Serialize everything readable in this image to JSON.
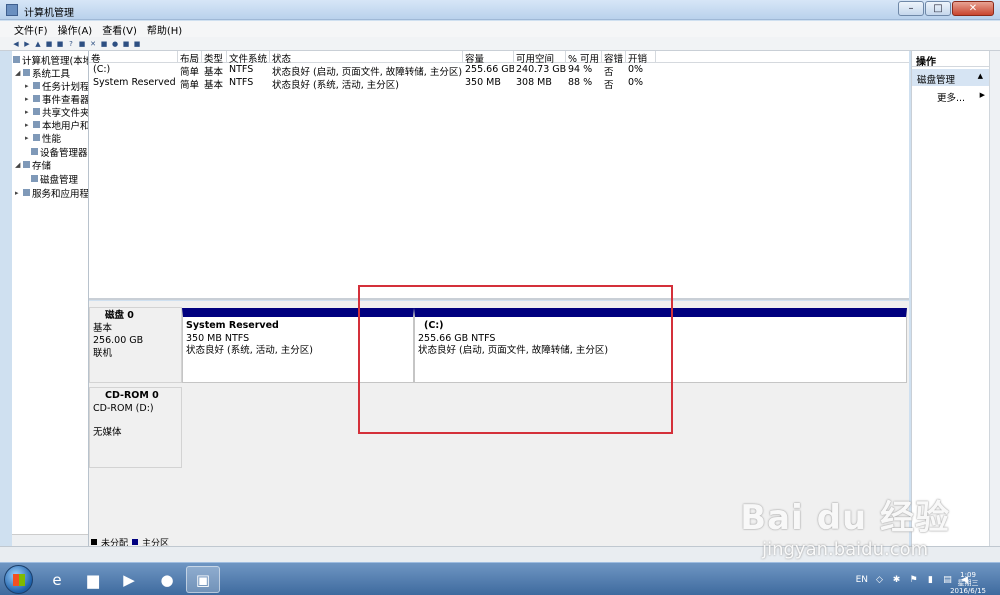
{
  "window": {
    "title": "计算机管理",
    "min": "–",
    "max": "□",
    "close": "✕"
  },
  "menu": [
    "文件(F)",
    "操作(A)",
    "查看(V)",
    "帮助(H)"
  ],
  "tree": {
    "root": "计算机管理(本地)",
    "items": [
      {
        "label": "系统工具",
        "level": 1
      },
      {
        "label": "任务计划程序",
        "level": 2
      },
      {
        "label": "事件查看器",
        "level": 2
      },
      {
        "label": "共享文件夹",
        "level": 2
      },
      {
        "label": "本地用户和组",
        "level": 2
      },
      {
        "label": "性能",
        "level": 2
      },
      {
        "label": "设备管理器",
        "level": 2
      },
      {
        "label": "存储",
        "level": 1
      },
      {
        "label": "磁盘管理",
        "level": 2
      },
      {
        "label": "服务和应用程序",
        "level": 1
      }
    ]
  },
  "volume_list": {
    "columns": [
      "卷",
      "布局",
      "类型",
      "文件系统",
      "状态",
      "容量",
      "可用空间",
      "% 可用",
      "容错",
      "开销"
    ],
    "rows": [
      [
        "(C:)",
        "简单",
        "基本",
        "NTFS",
        "状态良好 (启动, 页面文件, 故障转储, 主分区)",
        "255.66 GB",
        "240.73 GB",
        "94 %",
        "否",
        "0%"
      ],
      [
        "System Reserved",
        "简单",
        "基本",
        "NTFS",
        "状态良好 (系统, 活动, 主分区)",
        "350 MB",
        "308 MB",
        "88 %",
        "否",
        "0%"
      ]
    ]
  },
  "disks": [
    {
      "name": "磁盘 0",
      "type": "基本",
      "size": "256.00 GB",
      "status": "联机",
      "partitions": [
        {
          "name": "System Reserved",
          "size": "350 MB NTFS",
          "status": "状态良好 (系统, 活动, 主分区)"
        },
        {
          "name": "(C:)",
          "size": "255.66 GB NTFS",
          "status": "状态良好 (启动, 页面文件, 故障转储, 主分区)"
        }
      ]
    },
    {
      "name": "CD-ROM 0",
      "type": "CD-ROM (D:)",
      "media": "无媒体"
    }
  ],
  "legend": [
    "未分配",
    "主分区"
  ],
  "actions": {
    "header": "操作",
    "section": "磁盘管理",
    "more": "更多..."
  },
  "taskbar": {
    "lang": "EN",
    "time": "1:09",
    "day": "星期三",
    "date": "2016/6/15"
  },
  "watermark": {
    "logo": "Bai du 经验",
    "url": "jingyan.baidu.com"
  },
  "colors": {
    "partition_header": "#00007f",
    "highlight": "#d4303a"
  }
}
